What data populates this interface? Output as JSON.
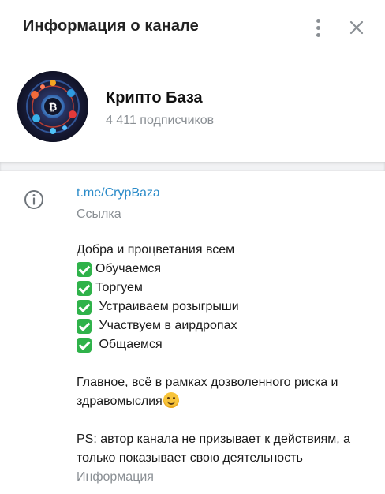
{
  "header": {
    "title": "Информация о канале",
    "menu_icon": "more-vertical-icon",
    "close_icon": "close-icon"
  },
  "channel": {
    "name": "Крипто База",
    "subscribers": "4 411 подписчиков"
  },
  "link": {
    "url": "t.me/CrypBaza",
    "caption": "Ссылка"
  },
  "description": {
    "intro": "Добра и процветания всем",
    "items": [
      "Обучаемся",
      "Торгуем",
      " Устраиваем розыгрыши",
      " Участвуем в аирдропах",
      " Общаемся"
    ],
    "para1": "Главное, всё в рамках дозволенного риска и здравомыслия",
    "para2": "PS: автор канала не призывает к действиям, а только показывает свою деятельность",
    "caption": "Информация"
  },
  "colors": {
    "accent_link": "#2a8bc9",
    "muted": "#8a8f94",
    "check_green": "#2fb24a"
  }
}
